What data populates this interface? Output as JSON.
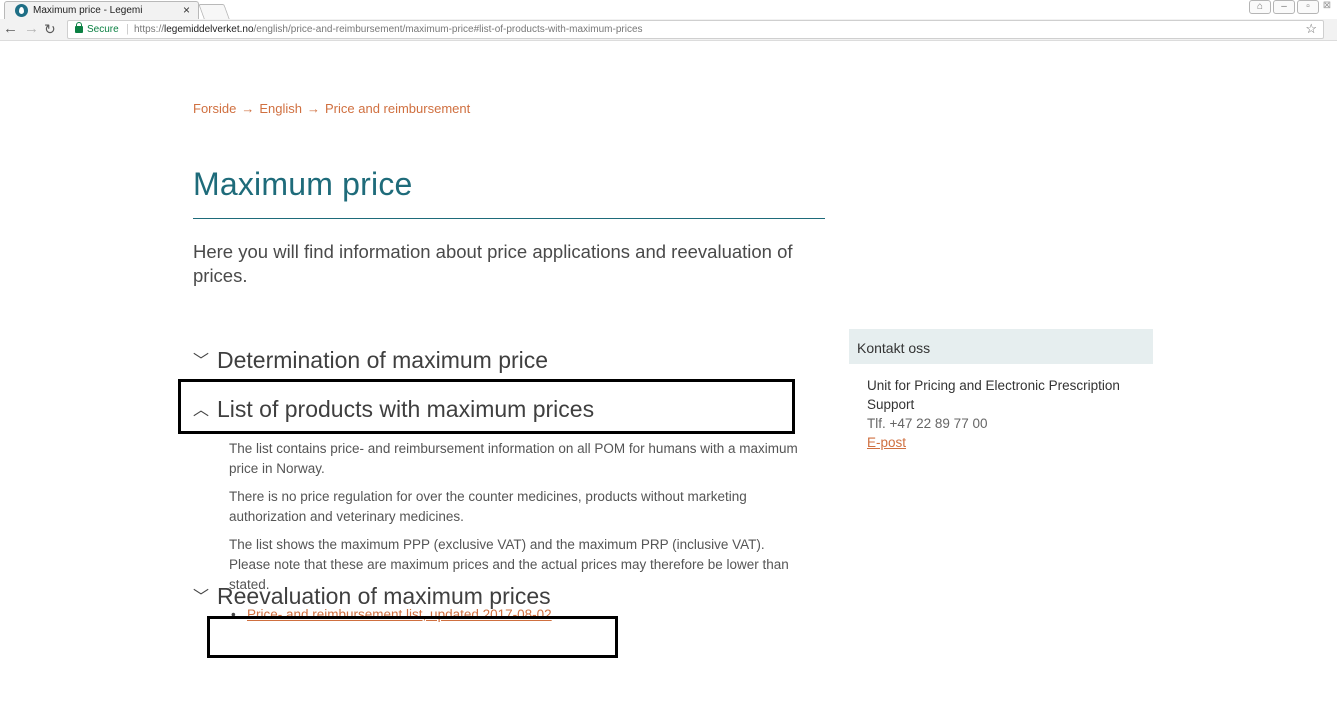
{
  "browser": {
    "tab_title": "Maximum price - Legemi",
    "tab_close": "×",
    "secure_label": "Secure",
    "url_scheme": "https://",
    "url_domain": "legemiddelverket.no",
    "url_path": "/english/price-and-reimbursement/maximum-price#list-of-products-with-maximum-prices",
    "nav_icons": [
      "back-arrow-icon",
      "forward-arrow-icon",
      "reload-icon"
    ],
    "secure_color": "#0b8043"
  },
  "breadcrumb": {
    "items": [
      "Forside",
      "English",
      "Price and reimbursement"
    ],
    "separator": "→"
  },
  "page": {
    "title": "Maximum price",
    "lead": "Here you will find information about price applications and reevaluation of prices."
  },
  "accordion": [
    {
      "label": "Determination of maximum price",
      "expanded": false
    },
    {
      "label": "List of products with maximum prices",
      "expanded": true,
      "paragraphs": [
        "The list contains price- and reimbursement information on all POM for humans with a maximum price in Norway.",
        "There is no price regulation for over the counter medicines, products without marketing authorization and veterinary medicines.",
        "The list shows the maximum PPP (exclusive VAT) and the maximum PRP (inclusive VAT). Please note that these are maximum prices and the actual prices may therefore be lower than stated."
      ],
      "link": "Price- and reimbursement list, updated 2017-08-02"
    },
    {
      "label": "Reevaluation of maximum prices",
      "expanded": false
    }
  ],
  "contact": {
    "heading": "Kontakt oss",
    "unit": "Unit for Pricing and Electronic Prescription Support",
    "phone": "Tlf. +47 22 89 77 00",
    "email_link": "E-post"
  },
  "colors": {
    "accent": "#1e6b7a",
    "link": "#d07040",
    "contact_header_bg": "#e6eeef"
  }
}
